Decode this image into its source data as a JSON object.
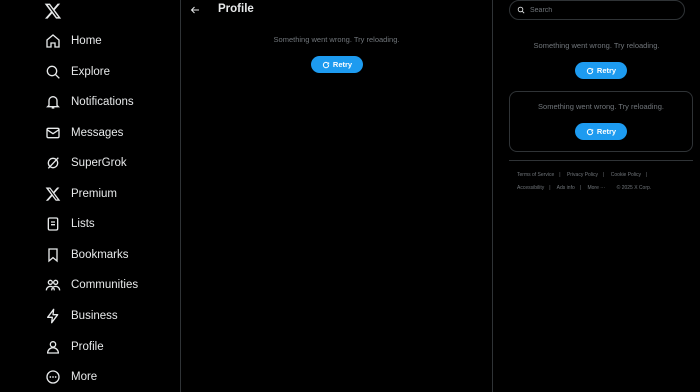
{
  "nav": {
    "items": [
      {
        "label": "Home",
        "icon": "home-icon"
      },
      {
        "label": "Explore",
        "icon": "search-icon"
      },
      {
        "label": "Notifications",
        "icon": "bell-icon"
      },
      {
        "label": "Messages",
        "icon": "envelope-icon"
      },
      {
        "label": "SuperGrok",
        "icon": "grok-icon"
      },
      {
        "label": "Premium",
        "icon": "x-logo-icon"
      },
      {
        "label": "Lists",
        "icon": "list-icon"
      },
      {
        "label": "Bookmarks",
        "icon": "bookmark-icon"
      },
      {
        "label": "Communities",
        "icon": "people-icon"
      },
      {
        "label": "Business",
        "icon": "lightning-icon"
      },
      {
        "label": "Profile",
        "icon": "person-icon"
      },
      {
        "label": "More",
        "icon": "more-circle-icon"
      }
    ]
  },
  "main": {
    "title": "Profile",
    "error_text": "Something went wrong. Try reloading.",
    "retry_label": "Retry"
  },
  "right": {
    "search_placeholder": "Search",
    "error_text_1": "Something went wrong. Try reloading.",
    "retry_label_1": "Retry",
    "error_text_2": "Something went wrong. Try reloading.",
    "retry_label_2": "Retry",
    "footer": {
      "terms": "Terms of Service",
      "privacy": "Privacy Policy",
      "cookie": "Cookie Policy",
      "accessibility": "Accessibility",
      "ads": "Ads info",
      "more": "More ···",
      "copyright": "© 2025 X Corp."
    }
  },
  "colors": {
    "accent": "#1d9bf0",
    "background": "#000000",
    "border": "#2f3336",
    "muted": "#71767b",
    "text": "#e7e9ea"
  }
}
